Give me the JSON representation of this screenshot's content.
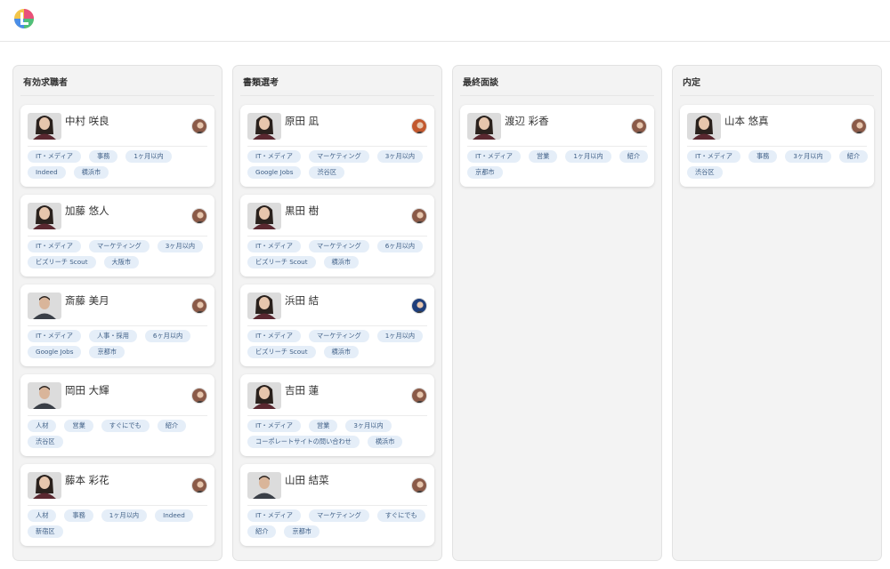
{
  "app": {
    "logo_icon": "multicolor-l-logo-icon"
  },
  "colors": {
    "tag_bg": "#e5eef8",
    "tag_text": "#3f5f86",
    "column_bg": "#f3f3f3",
    "card_bg": "#ffffff"
  },
  "columns": [
    {
      "title": "有効求職者",
      "cards": [
        {
          "name": "中村 咲良",
          "avatar": "female-photo",
          "owner_color": "#8a5a48",
          "tags": [
            "IT・メディア",
            "事務",
            "1ヶ月以内",
            "Indeed",
            "横浜市"
          ]
        },
        {
          "name": "加藤 悠人",
          "avatar": "female-photo",
          "owner_color": "#8a5a48",
          "tags": [
            "IT・メディア",
            "マーケティング",
            "3ヶ月以内",
            "ビズリーチ Scout",
            "大阪市"
          ]
        },
        {
          "name": "斎藤 美月",
          "avatar": "male-photo",
          "owner_color": "#8a5a48",
          "tags": [
            "IT・メディア",
            "人事・採用",
            "6ヶ月以内",
            "Google Jobs",
            "京都市"
          ]
        },
        {
          "name": "岡田 大輝",
          "avatar": "male-photo",
          "owner_color": "#8a5a48",
          "tags": [
            "人材",
            "営業",
            "すぐにでも",
            "紹介",
            "渋谷区"
          ]
        },
        {
          "name": "藤本 彩花",
          "avatar": "female-photo",
          "owner_color": "#8a5a48",
          "tags": [
            "人材",
            "事務",
            "1ヶ月以内",
            "Indeed",
            "新宿区"
          ]
        }
      ]
    },
    {
      "title": "書類選考",
      "cards": [
        {
          "name": "原田 凪",
          "avatar": "female-photo",
          "owner_color": "#c2582e",
          "tags": [
            "IT・メディア",
            "マーケティング",
            "3ヶ月以内",
            "Google Jobs",
            "渋谷区"
          ]
        },
        {
          "name": "黒田 樹",
          "avatar": "female-photo",
          "owner_color": "#8a5a48",
          "tags": [
            "IT・メディア",
            "マーケティング",
            "6ヶ月以内",
            "ビズリーチ Scout",
            "横浜市"
          ]
        },
        {
          "name": "浜田 結",
          "avatar": "female-photo",
          "owner_color": "#1f3e7a",
          "tags": [
            "IT・メディア",
            "マーケティング",
            "1ヶ月以内",
            "ビズリーチ Scout",
            "横浜市"
          ]
        },
        {
          "name": "吉田 蓮",
          "avatar": "female-photo",
          "owner_color": "#8a5a48",
          "tags": [
            "IT・メディア",
            "営業",
            "3ヶ月以内",
            "コーポレートサイトの問い合わせ",
            "横浜市"
          ]
        },
        {
          "name": "山田 結菜",
          "avatar": "male-photo",
          "owner_color": "#8a5a48",
          "tags": [
            "IT・メディア",
            "マーケティング",
            "すぐにでも",
            "紹介",
            "京都市"
          ]
        }
      ]
    },
    {
      "title": "最終面談",
      "cards": [
        {
          "name": "渡辺 彩香",
          "avatar": "female-photo",
          "owner_color": "#8a5a48",
          "tags": [
            "IT・メディア",
            "営業",
            "1ヶ月以内",
            "紹介",
            "京都市"
          ]
        }
      ]
    },
    {
      "title": "内定",
      "cards": [
        {
          "name": "山本 悠真",
          "avatar": "female-photo",
          "owner_color": "#8a5a48",
          "tags": [
            "IT・メディア",
            "事務",
            "3ヶ月以内",
            "紹介",
            "渋谷区"
          ]
        }
      ]
    }
  ]
}
